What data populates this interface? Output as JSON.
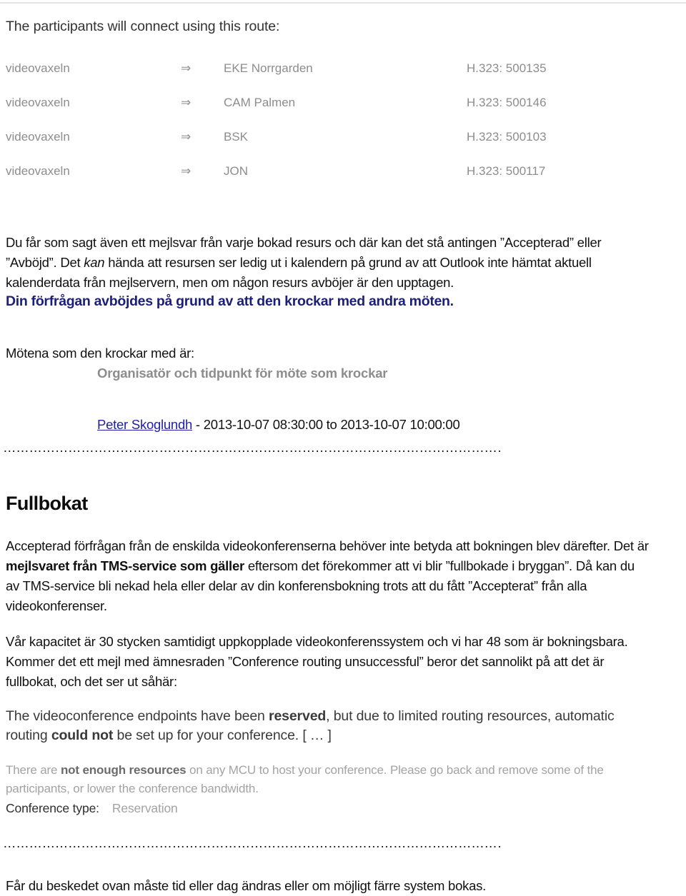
{
  "document": {
    "route_section": {
      "heading": "The participants will connect using this route:",
      "columns": [
        "source",
        "arrow",
        "destination",
        "number"
      ],
      "arrow_glyph": "⇒",
      "rows": [
        {
          "source": "videovaxeln",
          "arrow": "⇒",
          "destination": "EKE Norrgarden",
          "number": "H.323: 500135"
        },
        {
          "source": "videovaxeln",
          "arrow": "⇒",
          "destination": "CAM Palmen",
          "number": "H.323: 500146"
        },
        {
          "source": "videovaxeln",
          "arrow": "⇒",
          "destination": "BSK",
          "number": "H.323: 500103"
        },
        {
          "source": "videovaxeln",
          "arrow": "⇒",
          "destination": "JON",
          "number": "H.323: 500117"
        }
      ]
    },
    "accepted_paragraph": {
      "part1": "Du får som sagt även ett mejlsvar från varje bokad resurs och där kan det stå antingen ”Accepterad” eller ”Avböjd”. Det ",
      "italic": "kan",
      "part2": " hända att resursen ser ledig ut i kalendern på grund av att Outlook inte hämtat aktuell kalenderdata från mejlservern, men om någon resurs avböjer är den upptagen."
    },
    "declined": {
      "heading": "Din förfrågan avböjdes på grund av att den krockar med andra möten.",
      "intro": "Mötena som den krockar med är:",
      "organizer_heading": "Organisatör och tidpunkt för möte som krockar",
      "organizer_name": "Peter Skoglundh",
      "organizer_time": " - 2013-10-07 08:30:00 to 2013-10-07 10:00:00"
    },
    "separator_top": "…………………………………………………………………………………………………………………..",
    "separator_bottom": "…………………………………………………………………………………………………………………..",
    "fullbokat": {
      "heading": "Fullbokat",
      "part1": "Accepterad förfrågan från de enskilda videokonferenserna behöver inte betyda att bokningen blev därefter. Det är ",
      "bold1": "mejlsvaret från TMS-service som gäller",
      "part2": " eftersom det förekommer att vi blir ”fullbokade i bryggan”. Då kan du av TMS-service bli nekad hela eller delar av din konferensbokning trots att du fått ”Accepterat” från alla videokonferenser.",
      "capacity": "Vår kapacitet är 30 stycken samtidigt uppkopplade videokonferenssystem och vi har 48 som är bokningsbara. Kommer det ett mejl med ämnesraden ”Conference routing unsuccessful” beror det sannolikt på att det är fullbokat, och det ser ut såhär:"
    },
    "english_block": {
      "reserved_part1": "The videoconference endpoints have been ",
      "reserved_bold1": "reserved",
      "reserved_part2": ", but due to limited routing resources, automatic routing ",
      "reserved_bold2": "could not",
      "reserved_part3": " be set up for your conference. [ … ]",
      "resources_part1": "There are ",
      "resources_bold": "not enough resources",
      "resources_part2": " on any MCU to host your conference. Please go back and remove some of the participants, or lower the conference bandwidth.",
      "conference_type_label": "Conference type:",
      "conference_type_value": "Reservation"
    },
    "final_note": "Får du beskedet ovan måste tid eller dag ändras eller om möjligt färre system bokas.",
    "colors": {
      "navy_heading": "#1b1f77",
      "link_blue": "#1f1fa8",
      "route_gray": "#8d8d8d",
      "light_gray_text": "#a3a3a3",
      "rule_gray": "#e3e3e3"
    }
  }
}
